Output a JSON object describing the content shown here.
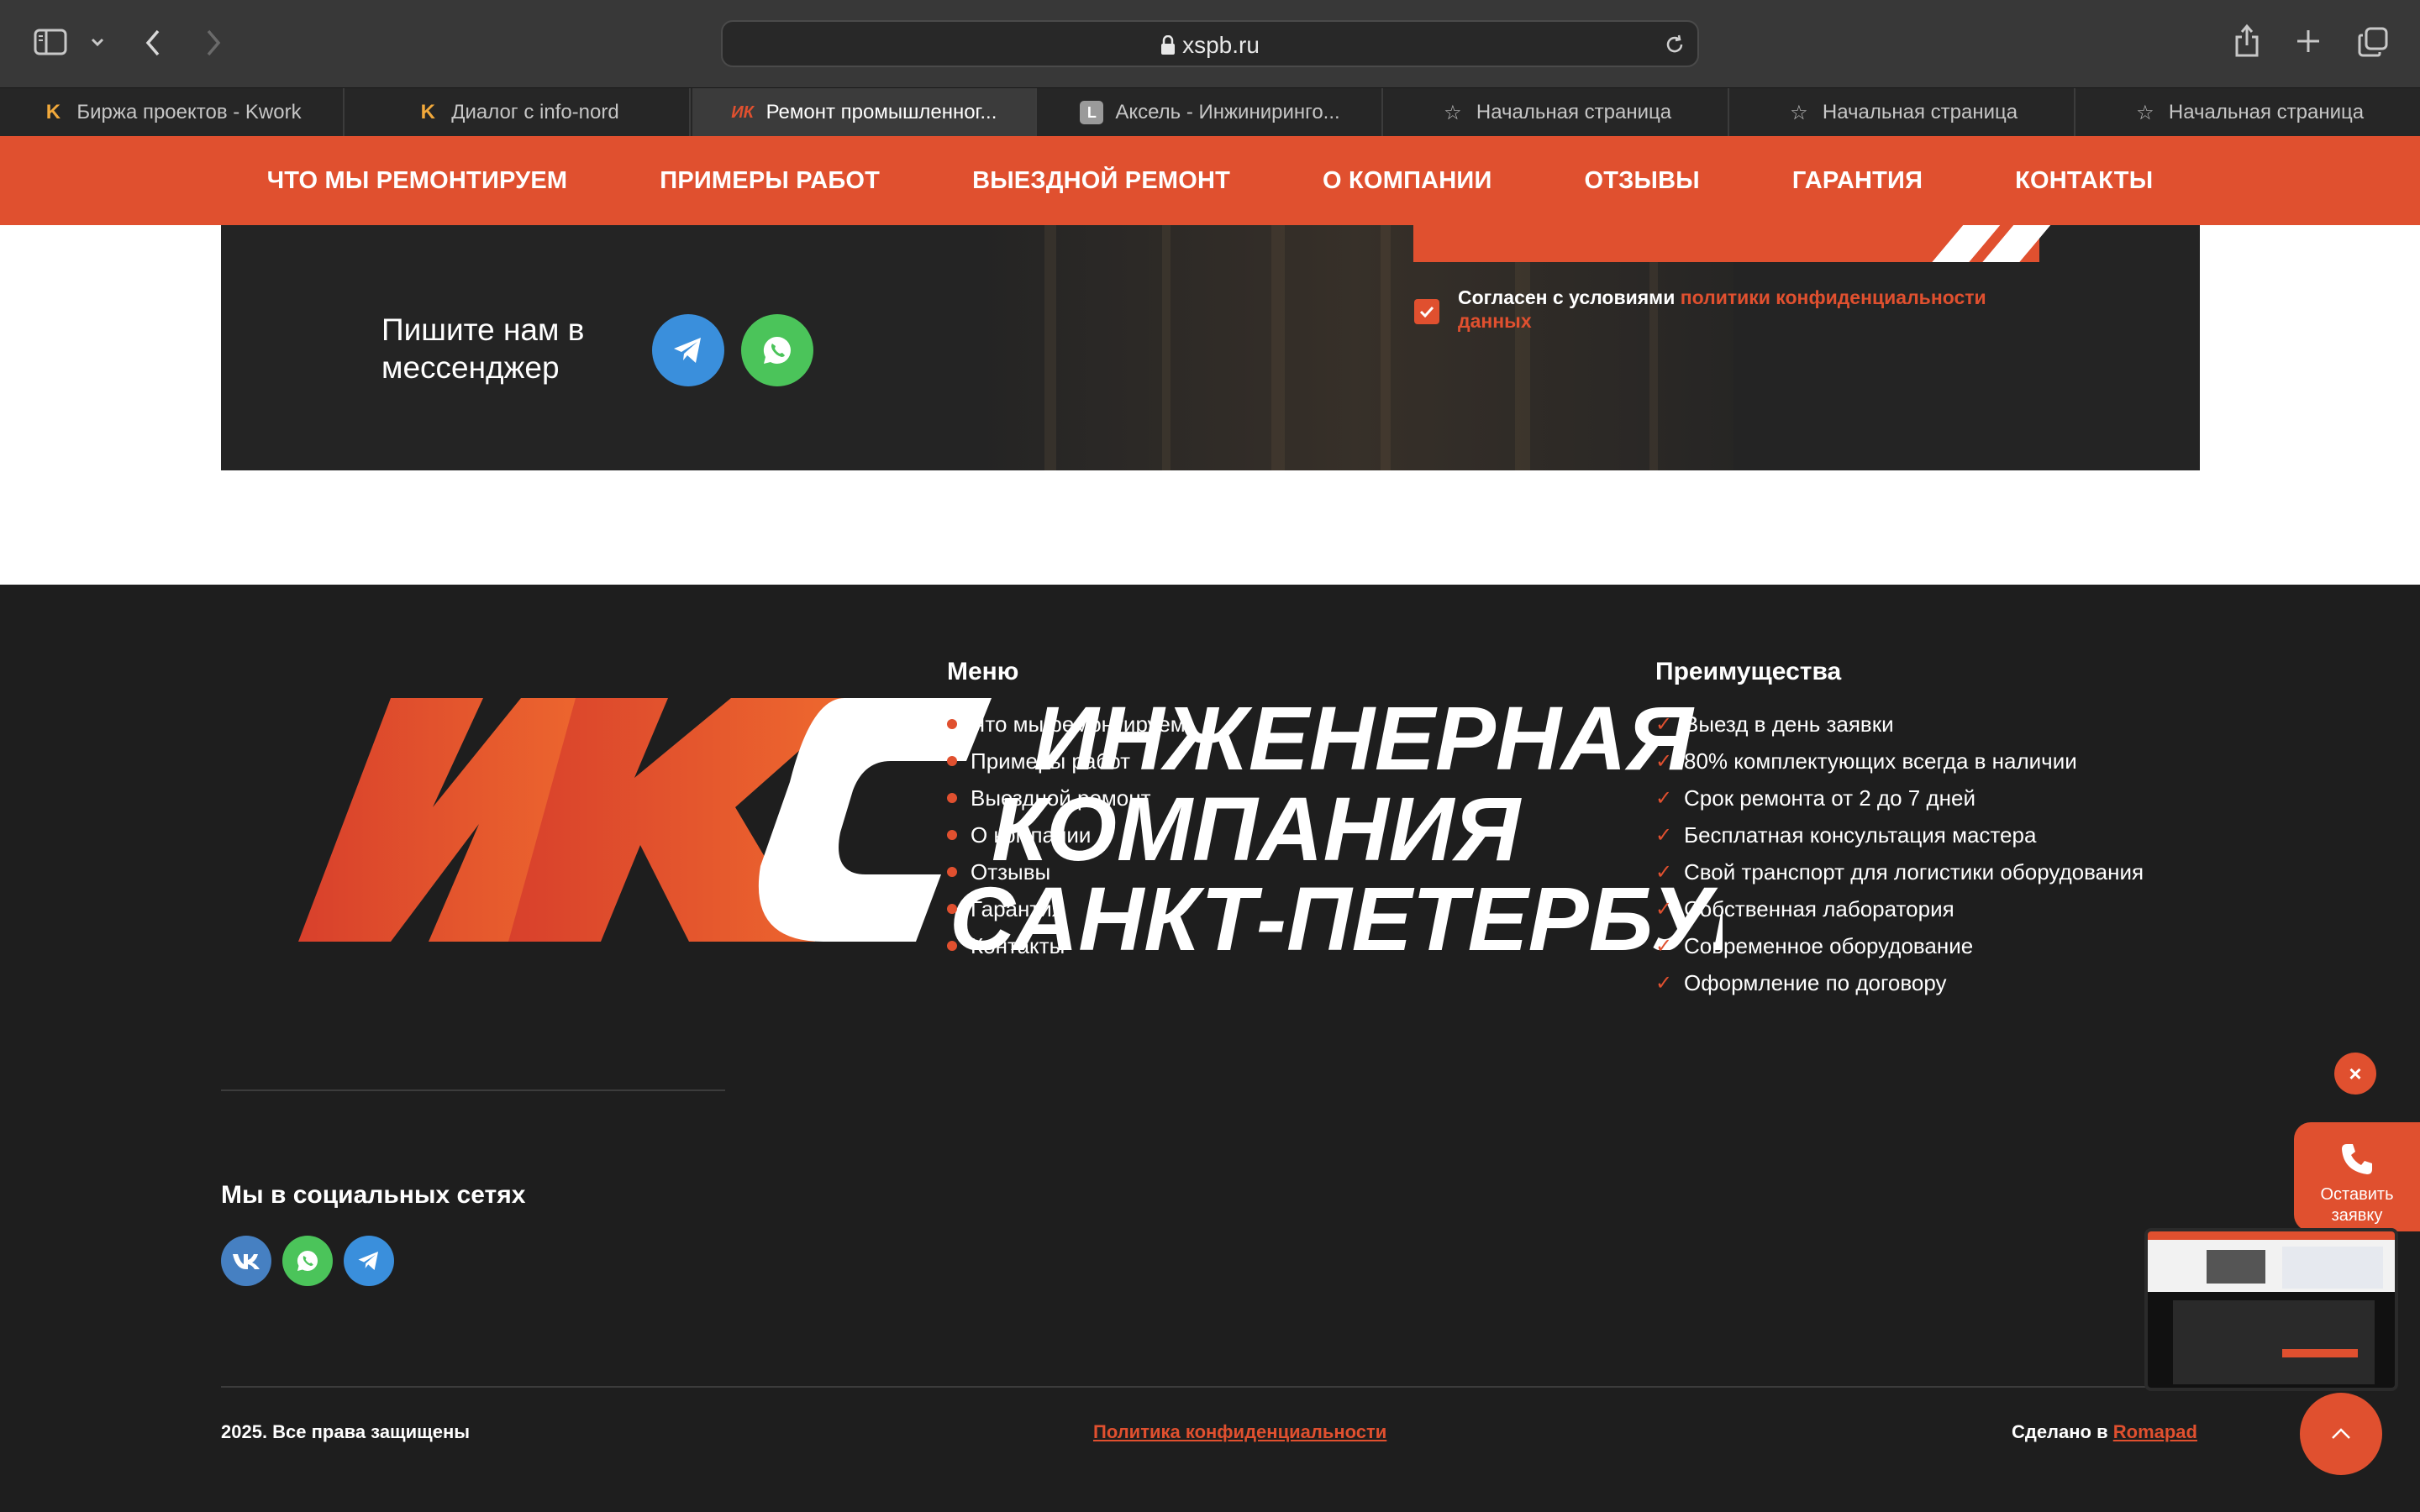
{
  "browser": {
    "url": "xspb.ru",
    "tabs": [
      {
        "label": "Биржа проектов - Kwork",
        "icon": "kwork-icon"
      },
      {
        "label": "Диалог с info-nord",
        "icon": "kwork-icon"
      },
      {
        "label": "Ремонт промышленног...",
        "icon": "iks-icon",
        "active": true
      },
      {
        "label": "Аксель - Инжиниринго...",
        "icon": "l-letter-icon"
      },
      {
        "label": "Начальная страница",
        "icon": "star-icon"
      },
      {
        "label": "Начальная страница",
        "icon": "star-icon"
      },
      {
        "label": "Начальная страница",
        "icon": "star-icon"
      }
    ]
  },
  "nav": {
    "items": [
      "ЧТО МЫ РЕМОНТИРУЕМ",
      "ПРИМЕРЫ РАБОТ",
      "ВЫЕЗДНОЙ РЕМОНТ",
      "О КОМПАНИИ",
      "ОТЗЫВЫ",
      "ГАРАНТИЯ",
      "КОНТАКТЫ"
    ]
  },
  "banner": {
    "messenger_label": "Пишите нам в мессенджер",
    "consent_prefix": "Согласен с условиями ",
    "consent_link": "политики конфиденциальности данных"
  },
  "footer": {
    "logo_letters": "ИКС",
    "logo_lines": [
      "ИНЖЕНЕРНАЯ",
      "КОМПАНИЯ",
      "САНКТ-ПЕТЕРБУРГА"
    ],
    "menu_title": "Меню",
    "menu_items": [
      "Что мы ремонтируем",
      "Примеры работ",
      "Выездной ремонт",
      "О компании",
      "Отзывы",
      "Гарантия",
      "Контакты"
    ],
    "advantages_title": "Преимущества",
    "advantages": [
      "Выезд в день заявки",
      "80% комплектующих всегда в наличии",
      "Срок ремонта от 2 до 7 дней",
      "Бесплатная консультация мастера",
      "Свой транспорт для логистики оборудования",
      "Собственная лаборатория",
      "Современное оборудование",
      "Оформление по договору"
    ],
    "social_title": "Мы в социальных сетях",
    "copyright": "2025. Все права защищены",
    "privacy": "Политика конфиденциальности",
    "made_by_prefix": "Сделано в ",
    "made_by_link": "Romapad"
  },
  "widgets": {
    "callback_label": "Оставить заявку",
    "close": "×"
  },
  "colors": {
    "accent": "#e0502f",
    "footer_bg": "#1e1e1e",
    "telegram": "#3a8fdc",
    "whatsapp": "#4bc45a",
    "vk": "#4680c2"
  }
}
